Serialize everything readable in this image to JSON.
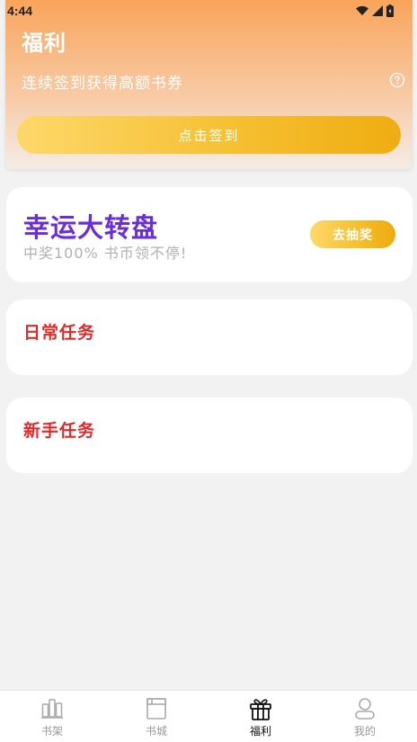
{
  "status_bar": {
    "time": "4:44"
  },
  "header": {
    "title": "福利",
    "subtitle": "连续签到获得高额书券",
    "signin_label": "点击签到"
  },
  "lottery": {
    "title": "幸运大转盘",
    "description": "中奖100% 书币领不停!",
    "button_label": "去抽奖"
  },
  "daily_tasks": {
    "title": "日常任务"
  },
  "newbie_tasks": {
    "title": "新手任务"
  },
  "bottom_nav": {
    "items": [
      {
        "label": "书架",
        "icon": "bookshelf-icon"
      },
      {
        "label": "书城",
        "icon": "bookstore-icon"
      },
      {
        "label": "福利",
        "icon": "gift-icon",
        "active": true
      },
      {
        "label": "我的",
        "icon": "profile-icon"
      }
    ]
  },
  "colors": {
    "accent_gold": "#f5be2e",
    "lottery_purple": "#6a2ed8",
    "task_red": "#e02a2a",
    "header_orange": "#f9a45a"
  }
}
